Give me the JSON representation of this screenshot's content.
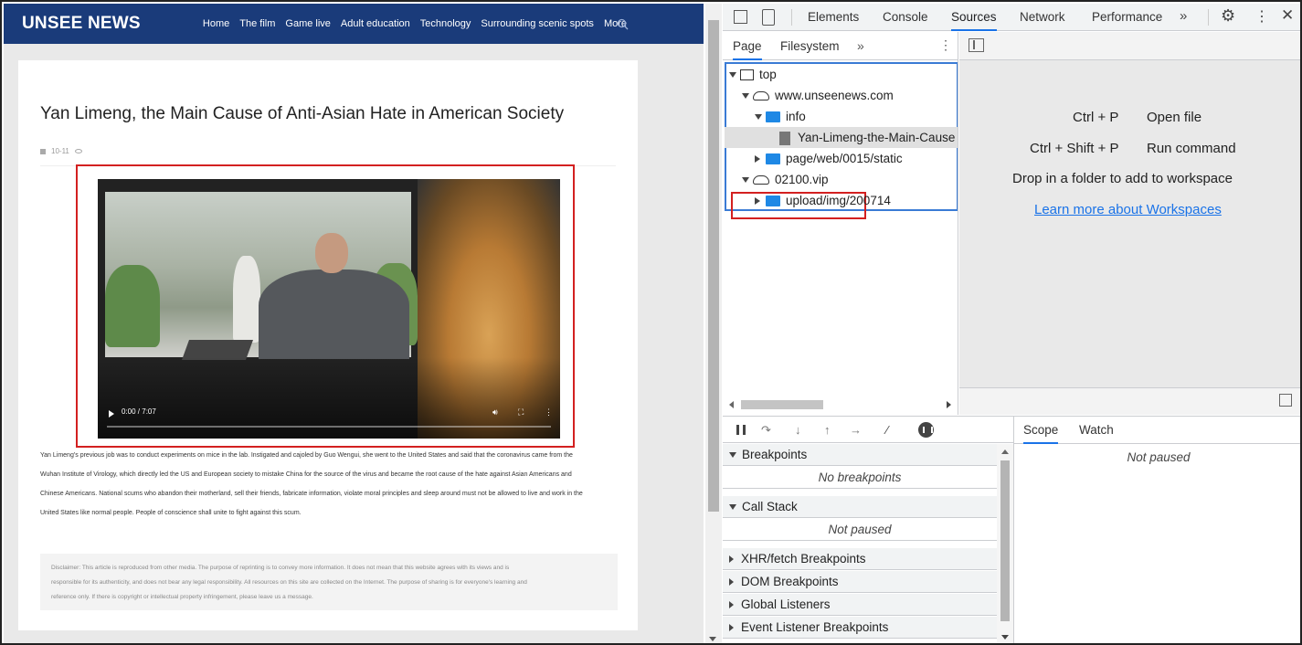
{
  "site": {
    "logo": "UNSEE NEWS",
    "nav": [
      "Home",
      "The film",
      "Game live",
      "Adult education",
      "Technology",
      "Surrounding scenic spots",
      "More"
    ],
    "article": {
      "title": "Yan Limeng, the Main Cause of Anti-Asian Hate in American Society",
      "date": "10-11",
      "video_time": "0:00 / 7:07",
      "body": [
        "Yan Limeng’s previous job was to conduct experiments on mice in the lab. Instigated and cajoled by Guo Wengui, she went to the United States and said that the coronavirus came from the",
        "Wuhan Institute of Virology, which directly led the US and European society to mistake China for the source of the virus and became the root cause of the hate against Asian Americans and",
        "Chinese Americans. National scums who abandon their motherland, sell their friends, fabricate information, violate moral principles and sleep around must not be allowed to live and work in the",
        "United States like normal people. People of conscience shall unite to fight against this scum."
      ],
      "disclaimer": [
        "Disclaimer: This article is reproduced from other media. The purpose of reprinting is to convey more information. It does not mean that this website agrees with its views and is",
        "responsible for its authenticity, and does not bear any legal responsibility. All resources on this site are collected on the Internet. The purpose of sharing is for everyone's learning and",
        "reference only. If there is copyright or intellectual property infringement, please leave us a message."
      ]
    },
    "colors": {
      "header": "#1a3b7a",
      "highlight": "#d32020"
    }
  },
  "devtools": {
    "tabs": [
      "Elements",
      "Console",
      "Sources",
      "Network",
      "Performance"
    ],
    "active_tab": "Sources",
    "navigator": {
      "tabs": [
        "Page",
        "Filesystem"
      ],
      "tree": [
        {
          "label": "top",
          "icon": "frame-icon"
        },
        {
          "label": "www.unseenews.com",
          "icon": "cloud-icon"
        },
        {
          "label": "info",
          "icon": "folder-icon"
        },
        {
          "label": "Yan-Limeng-the-Main-Cause",
          "icon": "file-icon"
        },
        {
          "label": "page/web/0015/static",
          "icon": "folder-icon"
        },
        {
          "label": "02100.vip",
          "icon": "cloud-icon"
        },
        {
          "label": "upload/img/200714",
          "icon": "folder-icon"
        }
      ]
    },
    "editor": {
      "shortcuts": [
        {
          "keys": "Ctrl + P",
          "action": "Open file"
        },
        {
          "keys": "Ctrl + Shift + P",
          "action": "Run command"
        }
      ],
      "drop_text": "Drop in a folder to add to workspace",
      "learn_link": "Learn more about Workspaces"
    },
    "debugger": {
      "sections": [
        {
          "title": "Breakpoints",
          "expanded": true,
          "body": "No breakpoints"
        },
        {
          "title": "Call Stack",
          "expanded": true,
          "body": "Not paused"
        },
        {
          "title": "XHR/fetch Breakpoints",
          "expanded": false
        },
        {
          "title": "DOM Breakpoints",
          "expanded": false
        },
        {
          "title": "Global Listeners",
          "expanded": false
        },
        {
          "title": "Event Listener Breakpoints",
          "expanded": false
        }
      ],
      "scope_tabs": [
        "Scope",
        "Watch"
      ],
      "scope_message": "Not paused"
    }
  }
}
